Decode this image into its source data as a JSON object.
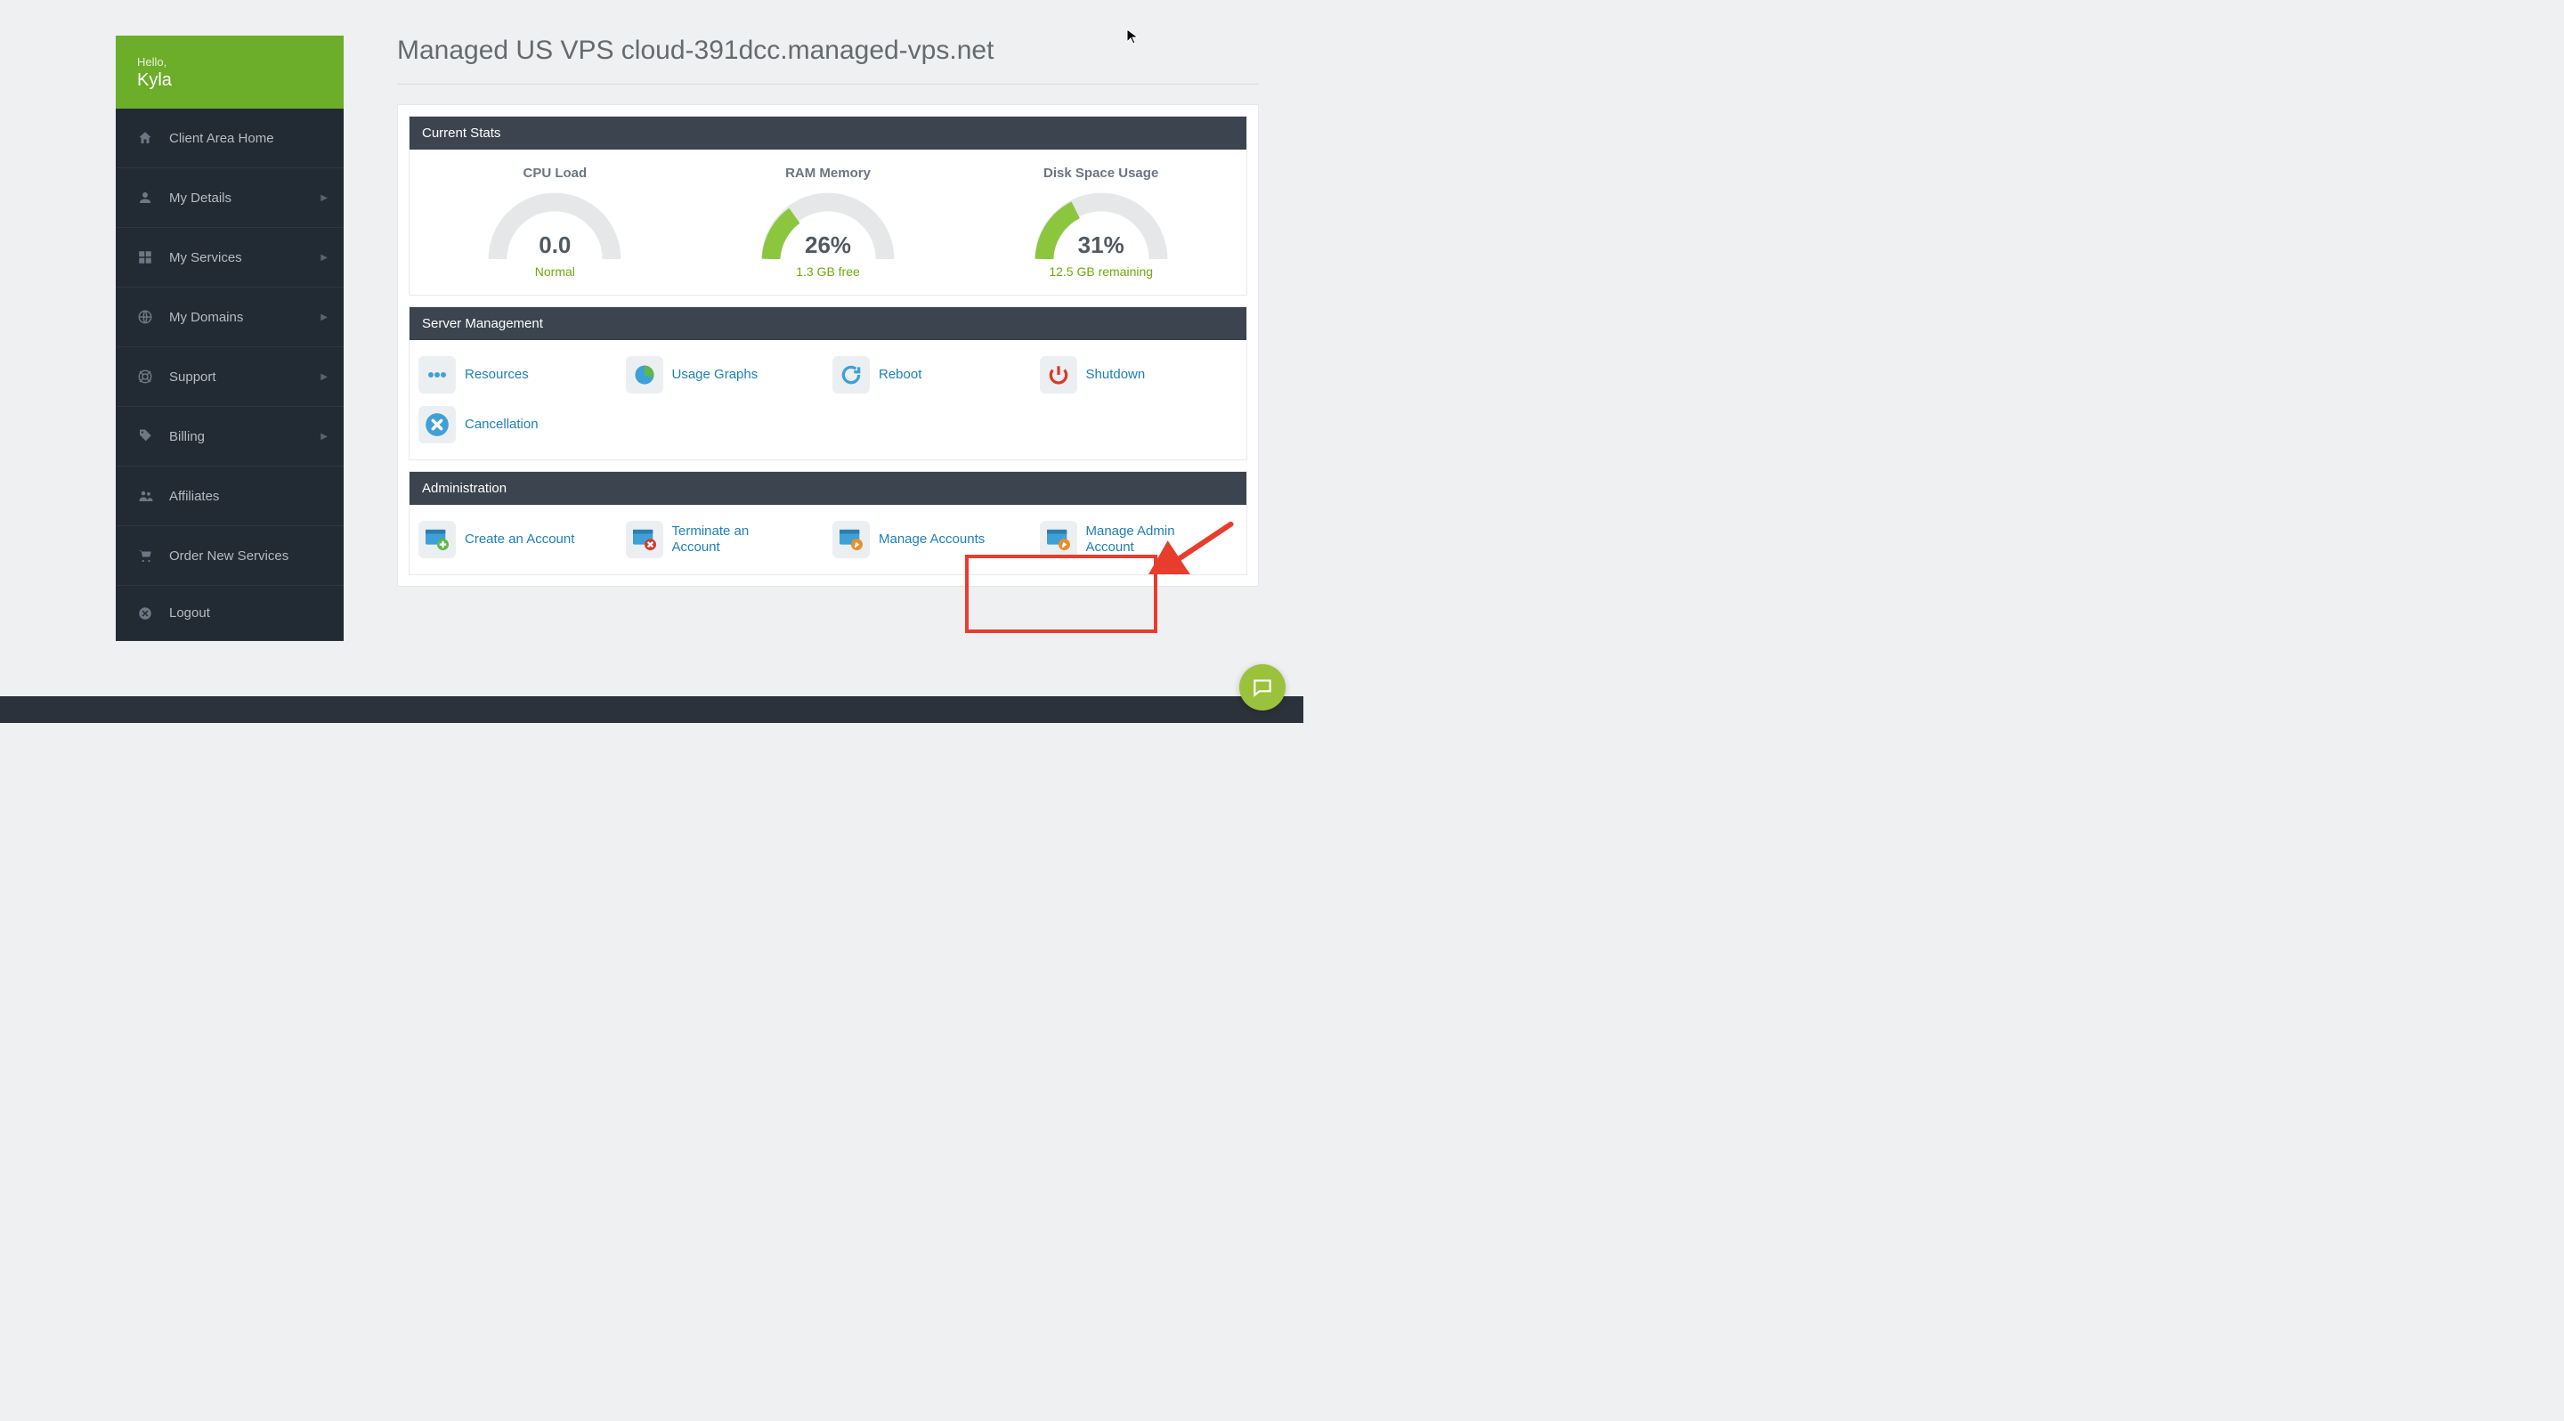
{
  "sidebar": {
    "hello": "Hello,",
    "name": "Kyla",
    "items": [
      {
        "label": "Client Area Home",
        "chev": false
      },
      {
        "label": "My Details",
        "chev": true
      },
      {
        "label": "My Services",
        "chev": true
      },
      {
        "label": "My Domains",
        "chev": true
      },
      {
        "label": "Support",
        "chev": true
      },
      {
        "label": "Billing",
        "chev": true
      },
      {
        "label": "Affiliates",
        "chev": false
      },
      {
        "label": "Order New Services",
        "chev": false
      },
      {
        "label": "Logout",
        "chev": false
      }
    ]
  },
  "page": {
    "title": "Managed US VPS cloud-391dcc.managed-vps.net"
  },
  "sections": {
    "stats_title": "Current Stats",
    "mgmt_title": "Server Management",
    "admin_title": "Administration"
  },
  "stats": {
    "cpu": {
      "title": "CPU Load",
      "value": "0.0",
      "pct": 0,
      "sub": "Normal"
    },
    "ram": {
      "title": "RAM Memory",
      "value": "26%",
      "pct": 26,
      "sub": "1.3 GB free"
    },
    "disk": {
      "title": "Disk Space Usage",
      "value": "31%",
      "pct": 31,
      "sub": "12.5 GB remaining"
    }
  },
  "mgmt": [
    {
      "label": "Resources"
    },
    {
      "label": "Usage Graphs"
    },
    {
      "label": "Reboot"
    },
    {
      "label": "Shutdown"
    },
    {
      "label": "Cancellation"
    }
  ],
  "admin": [
    {
      "label": "Create an Account"
    },
    {
      "label": "Terminate an Account"
    },
    {
      "label": "Manage Accounts"
    },
    {
      "label": "Manage Admin Account"
    }
  ],
  "colors": {
    "accent_green": "#6cad2a",
    "gauge_fill": "#8cc63f",
    "gauge_track": "#e5e7e9",
    "link": "#1e7fb8",
    "highlight": "#e83d2d"
  }
}
